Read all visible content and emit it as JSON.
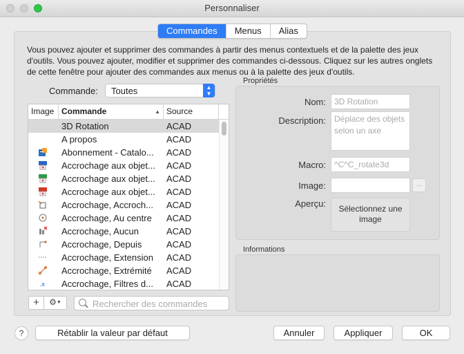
{
  "window": {
    "title": "Personnaliser"
  },
  "tabs": [
    {
      "label": "Commandes",
      "active": true
    },
    {
      "label": "Menus",
      "active": false
    },
    {
      "label": "Alias",
      "active": false
    }
  ],
  "intro_text": "Vous pouvez ajouter et supprimer des commandes à partir des menus contextuels et de la palette des jeux d'outils. Vous pouvez ajouter, modifier et supprimer des commandes ci-dessous. Cliquez sur les autres onglets de cette fenêtre pour ajouter des commandes aux menus ou à la palette des jeux d'outils.",
  "filter": {
    "label": "Commande:",
    "value": "Toutes"
  },
  "table": {
    "columns": {
      "image": "Image",
      "command": "Commande",
      "source": "Source"
    },
    "rows": [
      {
        "icon": "none",
        "command": "3D Rotation",
        "source": "ACAD",
        "selected": true
      },
      {
        "icon": "none",
        "command": "A propos",
        "source": "ACAD"
      },
      {
        "icon": "catalog-icon",
        "command": "Abonnement - Catalo...",
        "source": "ACAD"
      },
      {
        "icon": "dgn-file-icon",
        "command": "Accrochage aux objet...",
        "source": "ACAD"
      },
      {
        "icon": "dwf-file-icon",
        "command": "Accrochage aux objet...",
        "source": "ACAD"
      },
      {
        "icon": "pdf-file-icon",
        "command": "Accrochage aux objet...",
        "source": "ACAD"
      },
      {
        "icon": "snap-apparent-icon",
        "command": "Accrochage, Accroch...",
        "source": "ACAD"
      },
      {
        "icon": "snap-center-icon",
        "command": "Accrochage, Au centre",
        "source": "ACAD"
      },
      {
        "icon": "snap-none-icon",
        "command": "Accrochage, Aucun",
        "source": "ACAD"
      },
      {
        "icon": "snap-from-icon",
        "command": "Accrochage, Depuis",
        "source": "ACAD"
      },
      {
        "icon": "snap-extension-icon",
        "command": "Accrochage, Extension",
        "source": "ACAD"
      },
      {
        "icon": "snap-endpoint-icon",
        "command": "Accrochage, Extrémité",
        "source": "ACAD"
      },
      {
        "icon": "snap-filter-icon",
        "command": "Accrochage, Filtres d...",
        "source": "ACAD"
      }
    ]
  },
  "search": {
    "placeholder": "Rechercher des commandes"
  },
  "properties": {
    "title": "Propriétés",
    "name_label": "Nom:",
    "name_value": "3D Rotation",
    "description_label": "Description:",
    "description_value": "Déplace des objets selon un axe",
    "macro_label": "Macro:",
    "macro_value": "^C^C_rotate3d",
    "image_label": "Image:",
    "image_value": "",
    "browse_label": "...",
    "preview_label": "Aperçu:",
    "preview_button": "Sélectionnez une image"
  },
  "informations": {
    "title": "Informations"
  },
  "footer": {
    "help": "?",
    "reset": "Rétablir la valeur par défaut",
    "cancel": "Annuler",
    "apply": "Appliquer",
    "ok": "OK"
  },
  "colors": {
    "accent": "#2e7cf6",
    "maximize": "#2ec94a"
  }
}
